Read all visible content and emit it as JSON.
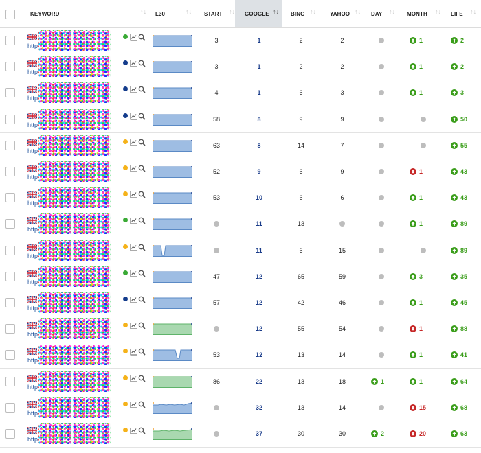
{
  "columns": {
    "keyword": "KEYWORD",
    "l30": "L30",
    "start": "START",
    "google": "GOOGLE",
    "bing": "BING",
    "yahoo": "YAHOO",
    "day": "DAY",
    "month": "MONTH",
    "life": "LIFE"
  },
  "sort_glyph": "↑↓",
  "url_prefix": "http",
  "colors": {
    "status_green": "#3aaa35",
    "status_navy": "#143c8c",
    "status_amber": "#f5b219",
    "spark_blue_fill": "#9ebde3",
    "spark_blue_line": "#5b8ac5",
    "spark_green_fill": "#a9d8b0",
    "spark_green_line": "#5fb36a",
    "up": "#3a9d1a",
    "down": "#c62828",
    "neutral": "#bdbdbd"
  },
  "rows": [
    {
      "status": "green",
      "spark": "blue",
      "start": "3",
      "google": "1",
      "bing": "2",
      "yahoo": "2",
      "day": {
        "dir": "none",
        "val": ""
      },
      "month": {
        "dir": "up",
        "val": "1"
      },
      "life": {
        "dir": "up",
        "val": "2"
      }
    },
    {
      "status": "navy",
      "spark": "blue",
      "start": "3",
      "google": "1",
      "bing": "2",
      "yahoo": "2",
      "day": {
        "dir": "none",
        "val": ""
      },
      "month": {
        "dir": "up",
        "val": "1"
      },
      "life": {
        "dir": "up",
        "val": "2"
      }
    },
    {
      "status": "navy",
      "spark": "blue",
      "start": "4",
      "google": "1",
      "bing": "6",
      "yahoo": "3",
      "day": {
        "dir": "none",
        "val": ""
      },
      "month": {
        "dir": "up",
        "val": "1"
      },
      "life": {
        "dir": "up",
        "val": "3"
      }
    },
    {
      "status": "navy",
      "spark": "blue",
      "start": "58",
      "google": "8",
      "bing": "9",
      "yahoo": "9",
      "day": {
        "dir": "none",
        "val": ""
      },
      "month": {
        "dir": "none",
        "val": ""
      },
      "life": {
        "dir": "up",
        "val": "50"
      }
    },
    {
      "status": "amber",
      "spark": "blue",
      "start": "63",
      "google": "8",
      "bing": "14",
      "yahoo": "7",
      "day": {
        "dir": "none",
        "val": ""
      },
      "month": {
        "dir": "none",
        "val": ""
      },
      "life": {
        "dir": "up",
        "val": "55"
      }
    },
    {
      "status": "amber",
      "spark": "blue",
      "start": "52",
      "google": "9",
      "bing": "6",
      "yahoo": "9",
      "day": {
        "dir": "none",
        "val": ""
      },
      "month": {
        "dir": "down",
        "val": "1"
      },
      "life": {
        "dir": "up",
        "val": "43"
      }
    },
    {
      "status": "amber",
      "spark": "blue",
      "start": "53",
      "google": "10",
      "bing": "6",
      "yahoo": "6",
      "day": {
        "dir": "none",
        "val": ""
      },
      "month": {
        "dir": "up",
        "val": "1"
      },
      "life": {
        "dir": "up",
        "val": "43"
      }
    },
    {
      "status": "green",
      "spark": "blue",
      "start": "",
      "google": "11",
      "bing": "13",
      "yahoo": "",
      "day": {
        "dir": "none",
        "val": ""
      },
      "month": {
        "dir": "up",
        "val": "1"
      },
      "life": {
        "dir": "up",
        "val": "89"
      }
    },
    {
      "status": "amber",
      "spark": "blue-dip",
      "start": "",
      "google": "11",
      "bing": "6",
      "yahoo": "15",
      "day": {
        "dir": "none",
        "val": ""
      },
      "month": {
        "dir": "none",
        "val": ""
      },
      "life": {
        "dir": "up",
        "val": "89"
      }
    },
    {
      "status": "green",
      "spark": "blue",
      "start": "47",
      "google": "12",
      "bing": "65",
      "yahoo": "59",
      "day": {
        "dir": "none",
        "val": ""
      },
      "month": {
        "dir": "up",
        "val": "3"
      },
      "life": {
        "dir": "up",
        "val": "35"
      }
    },
    {
      "status": "navy",
      "spark": "blue",
      "start": "57",
      "google": "12",
      "bing": "42",
      "yahoo": "46",
      "day": {
        "dir": "none",
        "val": ""
      },
      "month": {
        "dir": "up",
        "val": "1"
      },
      "life": {
        "dir": "up",
        "val": "45"
      }
    },
    {
      "status": "amber",
      "spark": "green",
      "start": "",
      "google": "12",
      "bing": "55",
      "yahoo": "54",
      "day": {
        "dir": "none",
        "val": ""
      },
      "month": {
        "dir": "down",
        "val": "1"
      },
      "life": {
        "dir": "up",
        "val": "88"
      }
    },
    {
      "status": "amber",
      "spark": "blue-dip2",
      "start": "53",
      "google": "12",
      "bing": "13",
      "yahoo": "14",
      "day": {
        "dir": "none",
        "val": ""
      },
      "month": {
        "dir": "up",
        "val": "1"
      },
      "life": {
        "dir": "up",
        "val": "41"
      }
    },
    {
      "status": "amber",
      "spark": "green",
      "start": "86",
      "google": "22",
      "bing": "13",
      "yahoo": "18",
      "day": {
        "dir": "up",
        "val": "1"
      },
      "month": {
        "dir": "up",
        "val": "1"
      },
      "life": {
        "dir": "up",
        "val": "64"
      }
    },
    {
      "status": "amber",
      "spark": "blue-wavy",
      "start": "",
      "google": "32",
      "bing": "13",
      "yahoo": "14",
      "day": {
        "dir": "none",
        "val": ""
      },
      "month": {
        "dir": "down",
        "val": "15"
      },
      "life": {
        "dir": "up",
        "val": "68"
      }
    },
    {
      "status": "amber",
      "spark": "green-wavy",
      "start": "",
      "google": "37",
      "bing": "30",
      "yahoo": "30",
      "day": {
        "dir": "up",
        "val": "2"
      },
      "month": {
        "dir": "down",
        "val": "20"
      },
      "life": {
        "dir": "up",
        "val": "63"
      }
    }
  ]
}
